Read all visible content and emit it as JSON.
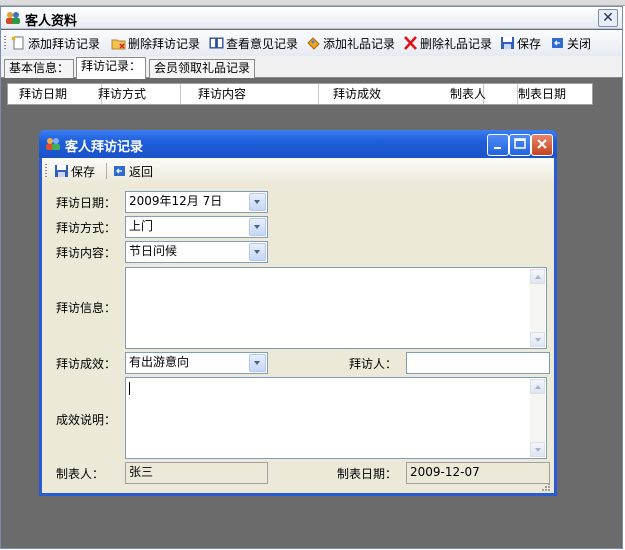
{
  "outer": {
    "title": "客人资料",
    "close_symbol": "✕",
    "toolbar": [
      {
        "label": "添加拜访记录",
        "icon": "new-document-icon"
      },
      {
        "label": "删除拜访记录",
        "icon": "folder-delete-icon"
      },
      {
        "label": "查看意见记录",
        "icon": "book-icon"
      },
      {
        "label": "添加礼品记录",
        "icon": "gift-icon"
      },
      {
        "label": "删除礼品记录",
        "icon": "red-x-icon"
      },
      {
        "label": "保存",
        "icon": "save-disk-icon"
      },
      {
        "label": "关闭",
        "icon": "close-app-icon"
      }
    ],
    "tabs": [
      "基本信息：",
      "拜访记录：",
      "会员领取礼品记录"
    ],
    "active_tab": 1,
    "columns": [
      "拜访日期",
      "拜访方式",
      "拜访内容",
      "拜访成效",
      "制表人",
      "制表日期"
    ]
  },
  "dialog": {
    "title": "客人拜访记录",
    "toolbar": [
      {
        "label": "保存",
        "icon": "save-disk-icon"
      },
      {
        "label": "返回",
        "icon": "return-icon"
      }
    ],
    "fields": {
      "visit_date_label": "拜访日期：",
      "visit_date_value": "2009年12月  7日",
      "visit_method_label": "拜访方式：",
      "visit_method_value": "上门",
      "visit_content_label": "拜访内容：",
      "visit_content_value": "节日问候",
      "visit_info_label": "拜访信息：",
      "visit_result_label": "拜访成效：",
      "visit_result_value": "有出游意向",
      "visitor_label": "拜访人：",
      "visitor_value": "",
      "result_note_label": "成效说明：",
      "creator_label": "制表人：",
      "creator_value": "张三",
      "create_date_label": "制表日期：",
      "create_date_value": "2009-12-07"
    }
  },
  "colors": {
    "dialog_title": "#1f5fdb",
    "backdrop": "#6b6b6b",
    "dialog_face": "#ece9d8"
  }
}
